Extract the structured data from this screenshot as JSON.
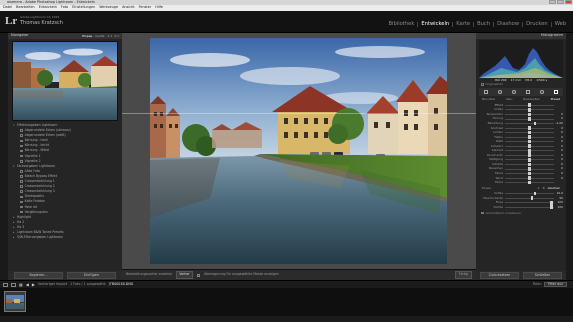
{
  "window": {
    "title": "okamera - Adobe Photoshop Lightroom - Entwickeln"
  },
  "menu": [
    "Datei",
    "Bearbeiten",
    "Entwickeln",
    "Foto",
    "Einstellungen",
    "Werkzeuge",
    "Ansicht",
    "Fenster",
    "Hilfe"
  ],
  "identity": {
    "logo": "Lr",
    "catalog": "Adobe Lightroom CC 2015",
    "user": "Thomas Kratzsch"
  },
  "modules": [
    "Bibliothek",
    "Entwickeln",
    "Karte",
    "Buch",
    "Diashow",
    "Drucken",
    "Web"
  ],
  "active_module": "Entwickeln",
  "navigator": {
    "label": "Navigator",
    "options": [
      "Einpas.",
      "Ausfül.",
      "1:1",
      "3:1"
    ]
  },
  "presets": [
    {
      "kind": "group",
      "label": "Effektvorgaben Lightroom"
    },
    {
      "kind": "item",
      "label": "Abgerundete Ecken (schwarz)"
    },
    {
      "kind": "item",
      "label": "Abgerundete Ecken (weiß)"
    },
    {
      "kind": "item",
      "label": "Körnung - hoch"
    },
    {
      "kind": "item",
      "label": "Körnung - leicht"
    },
    {
      "kind": "item",
      "label": "Körnung - Mittel"
    },
    {
      "kind": "item",
      "label": "Vignette 1"
    },
    {
      "kind": "item",
      "label": "Vignette 2"
    },
    {
      "kind": "group",
      "label": "Farbvorgaben Lightroom"
    },
    {
      "kind": "item",
      "label": "Altes Foto"
    },
    {
      "kind": "item",
      "label": "Bleach Bypass Effekt"
    },
    {
      "kind": "item",
      "label": "Crossentwicklung 1"
    },
    {
      "kind": "item",
      "label": "Crossentwicklung 2"
    },
    {
      "kind": "item",
      "label": "Crossentwicklung 3"
    },
    {
      "kind": "item",
      "label": "Direktpositiv"
    },
    {
      "kind": "item",
      "label": "Kalte Farbton"
    },
    {
      "kind": "item",
      "label": "Polar alt"
    },
    {
      "kind": "item",
      "label": "Vergilbungston"
    },
    {
      "kind": "folder",
      "label": "Highlight"
    },
    {
      "kind": "folder",
      "label": "Ha 2"
    },
    {
      "kind": "folder",
      "label": "Ha 3"
    },
    {
      "kind": "folder",
      "label": "Lightroom B&W Toned Presets"
    },
    {
      "kind": "folder",
      "label": "S/W-Filtervorgaben Lightroom"
    }
  ],
  "left_buttons": {
    "copy": "Kopieren...",
    "reset": "Einfügen"
  },
  "toolbar": {
    "soft_proof_label": "Bearbeitungsvorher ansehen",
    "mode_label": "Vorher",
    "overlay_label": "Überlagerung für ausgewählte Maske anzeigen",
    "done_label": "Fertig"
  },
  "histogram": {
    "label": "Histogramm",
    "exif": [
      "ISO 200",
      "17 mm",
      "f/8.0",
      "1/500 s"
    ]
  },
  "original_photo_label": "Originalfoto",
  "profile_tabs": [
    "Benutzer",
    "Neu",
    "Bearbeiten",
    "Preset"
  ],
  "adjustments": [
    {
      "label": "Effekt",
      "value": "",
      "pos": 0.5
    },
    {
      "label": "Größe",
      "value": "",
      "pos": 0.5
    },
    {
      "label": "Temperatur",
      "value": "0",
      "pos": 0.5
    },
    {
      "label": "Tönung",
      "value": "0",
      "pos": 0.5
    },
    {
      "label": "Belichtung",
      "value": "-1,00",
      "pos": 0.62
    },
    {
      "label": "Kontrast",
      "value": "0",
      "pos": 0.5
    },
    {
      "label": "Lichter",
      "value": "0",
      "pos": 0.5
    },
    {
      "label": "Tiefen",
      "value": "0",
      "pos": 0.5
    },
    {
      "label": "Weiß",
      "value": "0",
      "pos": 0.5
    },
    {
      "label": "Schwarz",
      "value": "0",
      "pos": 0.5
    },
    {
      "label": "Klarheit",
      "value": "0",
      "pos": 0.5
    },
    {
      "label": "Dunst entf.",
      "value": "0",
      "pos": 0.5
    },
    {
      "label": "Sättigung",
      "value": "0",
      "pos": 0.5
    },
    {
      "label": "Schärfe",
      "value": "0",
      "pos": 0.5
    },
    {
      "label": "Rauschen",
      "value": "0",
      "pos": 0.5
    },
    {
      "label": "Moiré",
      "value": "0",
      "pos": 0.5
    },
    {
      "label": "Rand",
      "value": "0",
      "pos": 0.5
    },
    {
      "label": "Farbe",
      "value": "",
      "pos": 0.5
    }
  ],
  "brush": {
    "label": "Pinsel",
    "size_tabs": [
      "A",
      "B",
      "Löschen"
    ]
  },
  "brush_sliders": [
    {
      "label": "Größe",
      "value": "10,0",
      "pos": 0.62
    },
    {
      "label": "Weiche Kante",
      "value": "50",
      "pos": 0.55
    },
    {
      "label": "Fluss",
      "value": "100",
      "pos": 0.95
    },
    {
      "label": "Dichte",
      "value": "100",
      "pos": 0.95
    }
  ],
  "auto_mask_label": "Automatisch maskieren",
  "right_buttons": {
    "reset": "Zurücksetzen",
    "close": "Schließen"
  },
  "filmstrip": {
    "source": "Vorheriger Import",
    "count": "1 Foto / 1 ausgewählt",
    "filename": "/TB0001B.DNG",
    "filter_label": "Filter:",
    "filter_value": "Filter aus"
  },
  "colors": {
    "active_module": "#ffffff",
    "panel_bg": "#252525",
    "center_bg": "#4a4a4a",
    "histogram_blue": "#3b63c9",
    "histogram_teal": "#4fb0b0",
    "histogram_yellow": "#d4c84a"
  }
}
